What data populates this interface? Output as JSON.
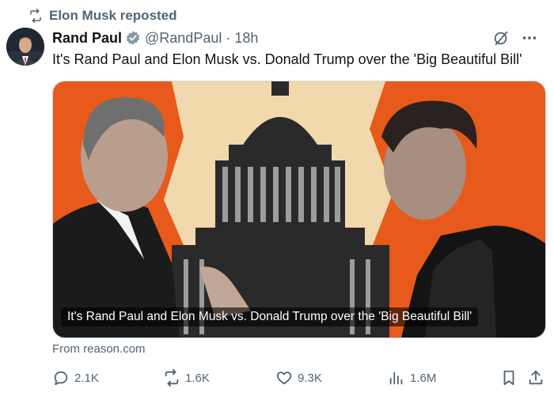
{
  "repost": {
    "label": "Elon Musk reposted"
  },
  "author": {
    "name": "Rand Paul",
    "handle": "@RandPaul",
    "separator": "·",
    "time": "18h"
  },
  "tweet": {
    "text": "It's Rand Paul and Elon Musk vs. Donald Trump over the 'Big Beautiful Bill'"
  },
  "card": {
    "title": "It's Rand Paul and Elon Musk vs. Donald Trump over the 'Big Beautiful Bill'",
    "source": "From reason.com"
  },
  "actions": {
    "replies": "2.1K",
    "reposts": "1.6K",
    "likes": "9.3K",
    "views": "1.6M"
  },
  "colors": {
    "secondary_text": "#536471",
    "verified_badge": "#829aab",
    "card_orange": "#e85a1c",
    "card_cream": "#f1d9ad"
  },
  "icons": [
    "repost-icon",
    "verified-badge-icon",
    "grok-icon",
    "more-icon",
    "reply-icon",
    "like-icon",
    "views-icon",
    "bookmark-icon",
    "share-icon"
  ]
}
